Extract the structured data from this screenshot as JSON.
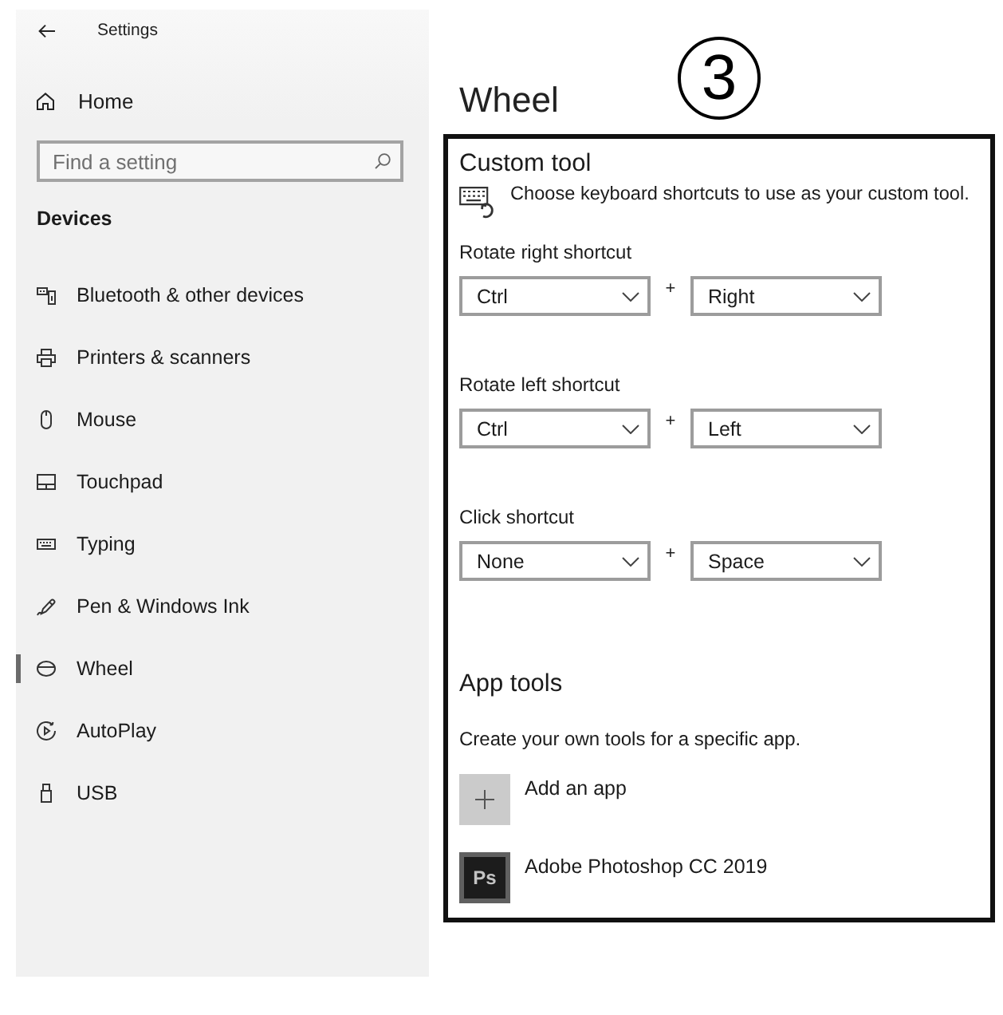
{
  "sidebar": {
    "title": "Settings",
    "home": "Home",
    "search": {
      "placeholder": "Find a setting"
    },
    "section": "Devices",
    "items": [
      {
        "label": "Bluetooth & other devices",
        "selected": false
      },
      {
        "label": "Printers & scanners",
        "selected": false
      },
      {
        "label": "Mouse",
        "selected": false
      },
      {
        "label": "Touchpad",
        "selected": false
      },
      {
        "label": "Typing",
        "selected": false
      },
      {
        "label": "Pen & Windows Ink",
        "selected": false
      },
      {
        "label": "Wheel",
        "selected": true
      },
      {
        "label": "AutoPlay",
        "selected": false
      },
      {
        "label": "USB",
        "selected": false
      }
    ]
  },
  "page": {
    "title": "Wheel",
    "step_marker": "3"
  },
  "custom_tool": {
    "title": "Custom tool",
    "description": "Choose keyboard shortcuts to use as your custom tool.",
    "shortcuts": [
      {
        "label": "Rotate right shortcut",
        "modifier": "Ctrl",
        "joiner": "+",
        "key": "Right"
      },
      {
        "label": "Rotate left shortcut",
        "modifier": "Ctrl",
        "joiner": "+",
        "key": "Left"
      },
      {
        "label": "Click shortcut",
        "modifier": "None",
        "joiner": "+",
        "key": "Space"
      }
    ]
  },
  "app_tools": {
    "title": "App tools",
    "description": "Create your own tools for a specific app.",
    "apps": [
      {
        "kind": "add",
        "label": "Add an app"
      },
      {
        "kind": "app",
        "label": "Adobe Photoshop CC 2019",
        "logo": "Ps"
      }
    ]
  }
}
